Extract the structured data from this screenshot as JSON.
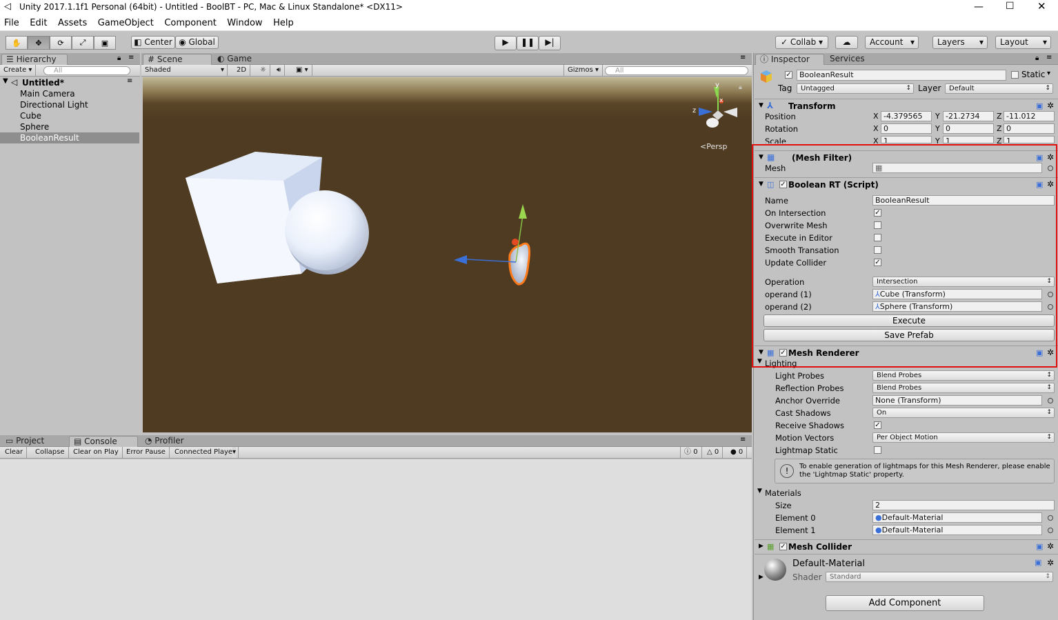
{
  "window": {
    "title": "Unity 2017.1.1f1 Personal (64bit) - Untitled - BoolBT - PC, Mac & Linux Standalone* <DX11>"
  },
  "menu": [
    "File",
    "Edit",
    "Assets",
    "GameObject",
    "Component",
    "Window",
    "Help"
  ],
  "toolbar": {
    "center": "Center",
    "global": "Global",
    "collab": "Collab",
    "account": "Account",
    "layers": "Layers",
    "layout": "Layout"
  },
  "hierarchy": {
    "tab": "Hierarchy",
    "create": "Create",
    "search_placeholder": "All",
    "scene": "Untitled*",
    "items": [
      "Main Camera",
      "Directional Light",
      "Cube",
      "Sphere",
      "BooleanResult"
    ],
    "selected": "BooleanResult"
  },
  "scene": {
    "tabs": [
      "Scene",
      "Game"
    ],
    "shading": "Shaded",
    "mode2d": "2D",
    "gizmos": "Gizmos",
    "search_placeholder": "All",
    "persp": "Persp",
    "axis_labels": {
      "y": "y",
      "z": "z",
      "x": "x"
    }
  },
  "bottom": {
    "tabs": [
      "Project",
      "Console",
      "Profiler"
    ],
    "buttons": [
      "Clear",
      "Collapse",
      "Clear on Play",
      "Error Pause",
      "Connected Player"
    ],
    "counts": [
      "0",
      "0",
      "0"
    ]
  },
  "inspector": {
    "tabs": [
      "Inspector",
      "Services"
    ],
    "object_name": "BooleanResult",
    "static_label": "Static",
    "tag_label": "Tag",
    "tag": "Untagged",
    "layer_label": "Layer",
    "layer": "Default",
    "transform": {
      "title": "Transform",
      "position_label": "Position",
      "rotation_label": "Rotation",
      "scale_label": "Scale",
      "position": [
        "-4.379565",
        "-21.2734",
        "-11.012"
      ],
      "rotation": [
        "0",
        "0",
        "0"
      ],
      "scale": [
        "1",
        "1",
        "1"
      ],
      "axes": [
        "X",
        "Y",
        "Z"
      ]
    },
    "mesh_filter": {
      "title": "(Mesh Filter)",
      "mesh_label": "Mesh"
    },
    "boolean_rt": {
      "title": "Boolean RT (Script)",
      "name_label": "Name",
      "name_value": "BooleanResult",
      "toggles": [
        {
          "label": "On Intersection",
          "checked": true
        },
        {
          "label": "Overwrite Mesh",
          "checked": false
        },
        {
          "label": "Execute in Editor",
          "checked": false
        },
        {
          "label": "Smooth Transation",
          "checked": false
        },
        {
          "label": "Update Collider",
          "checked": true
        }
      ],
      "operation_label": "Operation",
      "operation": "Intersection",
      "operand1_label": "operand (1)",
      "operand1": "Cube (Transform)",
      "operand2_label": "operand (2)",
      "operand2": "Sphere (Transform)",
      "execute": "Execute",
      "save_prefab": "Save Prefab"
    },
    "mesh_renderer": {
      "title": "Mesh Renderer",
      "lighting": "Lighting",
      "light_probes_label": "Light Probes",
      "light_probes": "Blend Probes",
      "reflection_probes_label": "Reflection Probes",
      "reflection_probes": "Blend Probes",
      "anchor_label": "Anchor Override",
      "anchor": "None (Transform)",
      "cast_shadows_label": "Cast Shadows",
      "cast_shadows": "On",
      "receive_shadows_label": "Receive Shadows",
      "motion_vectors_label": "Motion Vectors",
      "motion_vectors": "Per Object Motion",
      "lightmap_static_label": "Lightmap Static",
      "info": "To enable generation of lightmaps for this Mesh Renderer, please enable the 'Lightmap Static' property.",
      "materials": "Materials",
      "size_label": "Size",
      "size": "2",
      "element0_label": "Element 0",
      "element0": "Default-Material",
      "element1_label": "Element 1",
      "element1": "Default-Material"
    },
    "mesh_collider": {
      "title": "Mesh Collider"
    },
    "material": {
      "name": "Default-Material",
      "shader_label": "Shader",
      "shader": "Standard"
    },
    "add_component": "Add Component"
  },
  "colors": {
    "scene_ground": "#4e3b21",
    "selection": "#ff7a1a",
    "highlight": "#e01010"
  }
}
